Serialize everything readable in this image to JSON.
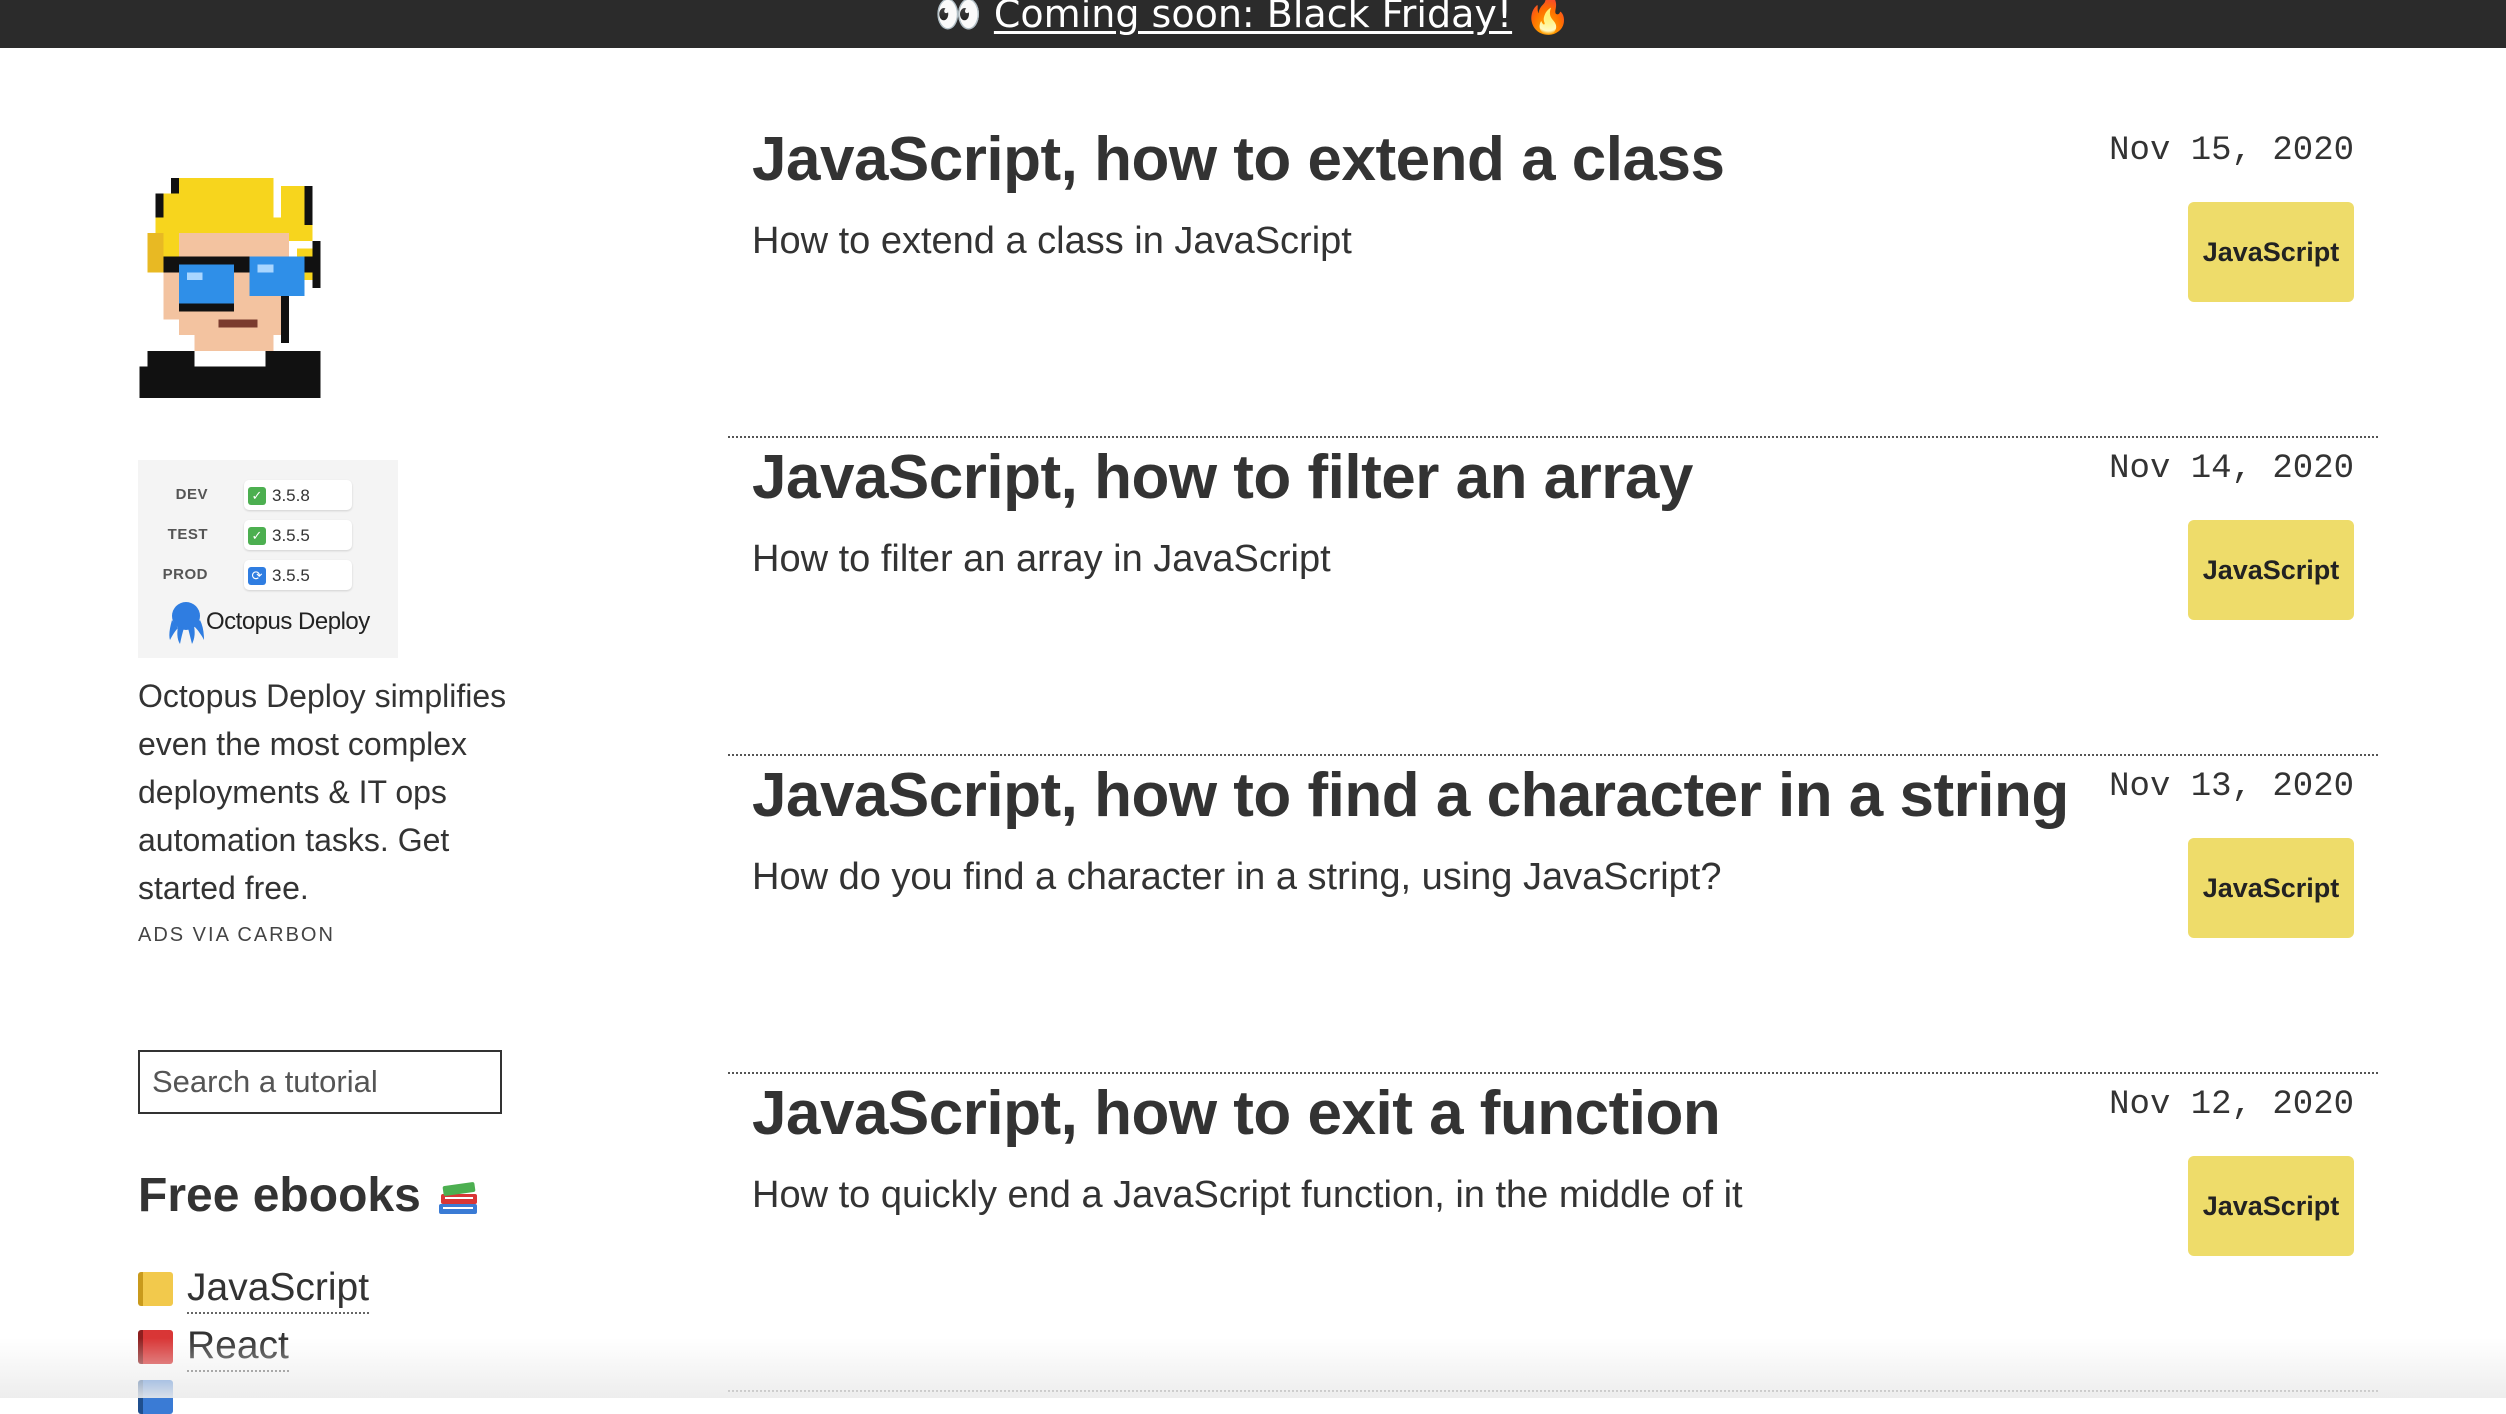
{
  "banner": {
    "prefix_emoji": "👀",
    "link_text": "Coming soon: Black Friday!",
    "suffix_emoji": "🔥",
    "background": "#2b2b2b"
  },
  "sidebar": {
    "avatar": {
      "icon": "pixel-avatar-with-sunglasses"
    },
    "ad": {
      "environments": [
        {
          "env": "DEV",
          "version": "3.5.8",
          "status": "success"
        },
        {
          "env": "TEST",
          "version": "3.5.5",
          "status": "success"
        },
        {
          "env": "PROD",
          "version": "3.5.5",
          "status": "in-progress"
        }
      ],
      "brand": "Octopus Deploy",
      "text": "Octopus Deploy simplifies even the most complex deployments & IT ops automation tasks. Get started free.",
      "via": "ADS VIA CARBON"
    },
    "search": {
      "placeholder": "Search a tutorial",
      "value": ""
    },
    "ebooks": {
      "title": "Free ebooks",
      "title_icon": "books-icon",
      "items": [
        {
          "label": "JavaScript",
          "icon_color": "#f2c94c"
        },
        {
          "label": "React",
          "icon_color": "#d93636"
        }
      ]
    }
  },
  "posts": [
    {
      "title": "JavaScript, how to extend a class",
      "description": "How to extend a class in JavaScript",
      "date": "Nov 15, 2020",
      "tag": "JavaScript"
    },
    {
      "title": "JavaScript, how to filter an array",
      "description": "How to filter an array in JavaScript",
      "date": "Nov 14, 2020",
      "tag": "JavaScript"
    },
    {
      "title": "JavaScript, how to find a character in a string",
      "description": "How do you find a character in a string, using JavaScript?",
      "date": "Nov 13, 2020",
      "tag": "JavaScript"
    },
    {
      "title": "JavaScript, how to exit a function",
      "description": "How to quickly end a JavaScript function, in the middle of it",
      "date": "Nov 12, 2020",
      "tag": "JavaScript"
    }
  ],
  "colors": {
    "tag_background": "#eedc6a",
    "text": "#333333",
    "success": "#4caf50",
    "in_progress": "#2f7de1"
  }
}
